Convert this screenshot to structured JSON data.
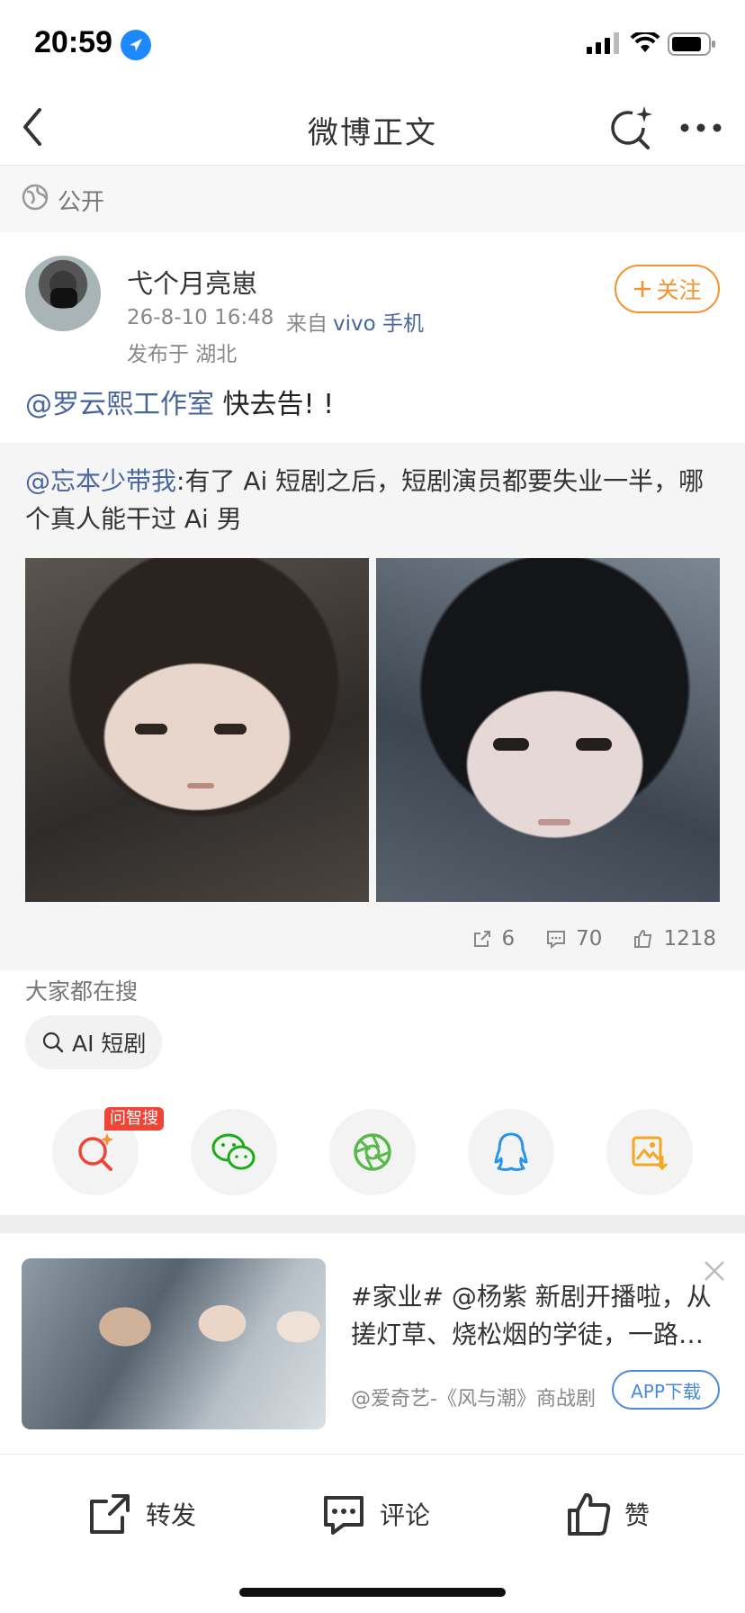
{
  "status_bar": {
    "time": "20:59"
  },
  "nav": {
    "title": "微博正文"
  },
  "visibility": {
    "label": "公开"
  },
  "post": {
    "username": "弋个月亮崽",
    "time": "26-8-10 16:48",
    "from_label": "来自",
    "device": "vivo 手机",
    "location": "发布于 湖北",
    "follow_label": "关注",
    "mention": "@罗云熙工作室",
    "text": " 快去告! !"
  },
  "repost": {
    "mention": "@忘本少带我",
    "text": ":有了 Ai 短剧之后，短剧演员都要失业一半，哪个真人能干过 Ai 男",
    "stats": {
      "reposts": "6",
      "comments": "70",
      "likes": "1218"
    }
  },
  "search": {
    "label": "大家都在搜",
    "chip": "AI 短剧"
  },
  "share": {
    "badge": "问智搜"
  },
  "ad": {
    "text": "#家业# @杨紫 新剧开播啦，从搓灯草、烧松烟的学徒，一路成为一代墨业宗师",
    "source": "@爱奇艺-《风与潮》商战剧",
    "button": "APP下载"
  },
  "bottom_bar": {
    "repost": "转发",
    "comment": "评论",
    "like": "赞"
  },
  "colors": {
    "link": "#48669c",
    "follow": "#f5922d",
    "ad_button": "#4a8ad8",
    "badge": "#f04436"
  }
}
